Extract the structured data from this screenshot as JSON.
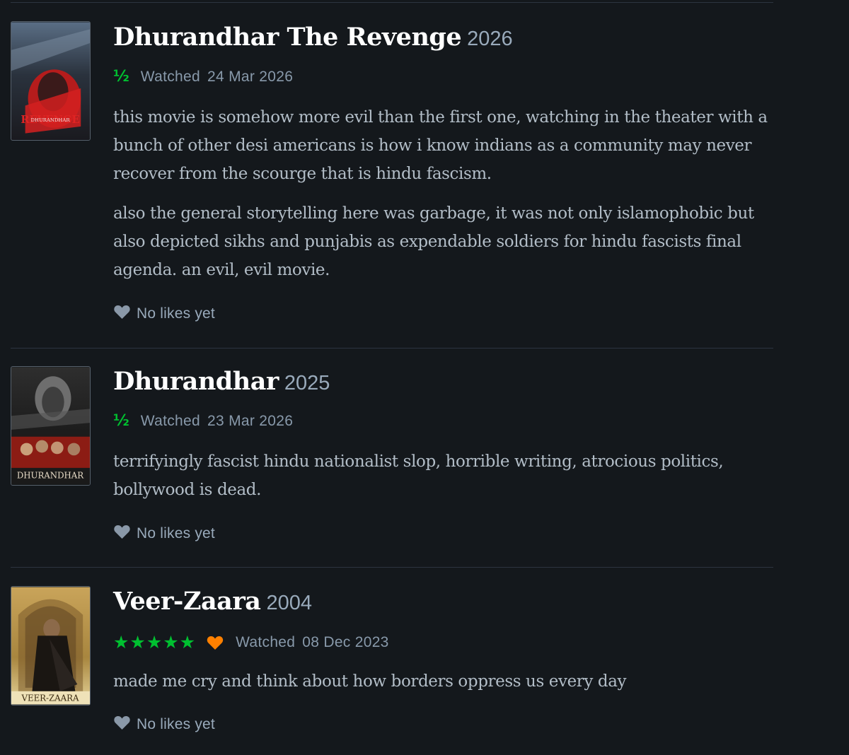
{
  "reviews": [
    {
      "title": "Dhurandhar The Revenge",
      "year": "2026",
      "rating": "½",
      "watched_label": "Watched",
      "watched_date": "24 Mar 2026",
      "paragraphs": [
        "this movie is somehow more evil than the first one, watching in the theater with a bunch of other desi americans is how i know indians as a community may never recover from the scourge that is hindu fascism.",
        "also the general storytelling here was garbage, it was not only islamophobic but also depicted sikhs and punjabis as expendable soldiers for hindu fascists final agenda. an evil, evil movie."
      ],
      "likes_text": "No likes yet",
      "poster_text": "DHURANDHAR"
    },
    {
      "title": "Dhurandhar",
      "year": "2025",
      "rating": "½",
      "watched_label": "Watched",
      "watched_date": "23 Mar 2026",
      "paragraphs": [
        "terrifyingly fascist hindu nationalist slop, horrible writing, atrocious politics, bollywood is dead."
      ],
      "likes_text": "No likes yet",
      "poster_text": "DHURANDHAR"
    },
    {
      "title": "Veer-Zaara",
      "year": "2004",
      "rating": "★★★★★",
      "liked": true,
      "watched_label": "Watched",
      "watched_date": "08 Dec 2023",
      "paragraphs": [
        "made me cry and think about how borders oppress us every day"
      ],
      "likes_text": "No likes yet",
      "poster_text": "VEER-ZAARA"
    }
  ],
  "colors": {
    "background": "#14181c",
    "star_green": "#00c030",
    "like_orange": "#ff8000",
    "text_muted": "#99aabb",
    "title_white": "#ffffff"
  },
  "icons": [
    "heart-icon",
    "liked-heart-icon",
    "star-icon"
  ]
}
